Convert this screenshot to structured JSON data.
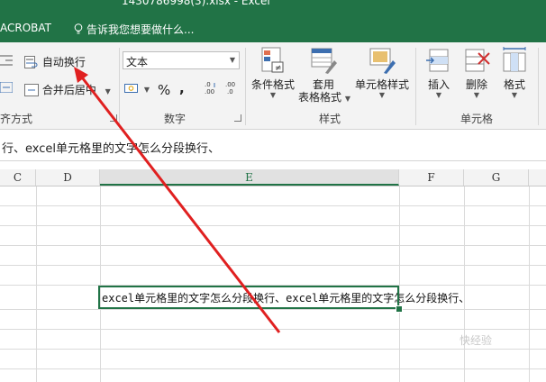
{
  "window": {
    "title": "1430786998(3).xlsx - Excel"
  },
  "menubar": {
    "tab": "ACROBAT",
    "tell_me": "告诉我您想要做什么..."
  },
  "ribbon": {
    "alignment": {
      "wrap_text": "自动换行",
      "merge_center": "合并后居中",
      "group_label": "齐方式"
    },
    "number": {
      "format_value": "文本",
      "percent": "%",
      "comma": ",",
      "group_label": "数字"
    },
    "styles": {
      "conditional": "条件格式",
      "table_line1": "套用",
      "table_line2": "表格格式",
      "cell_styles": "单元格样式",
      "group_label": "样式"
    },
    "cells": {
      "insert": "插入",
      "delete": "删除",
      "format": "格式",
      "group_label": "单元格"
    }
  },
  "formula_bar": {
    "content": "行、excel单元格里的文字怎么分段换行、"
  },
  "columns": [
    {
      "name": "C",
      "selected": false
    },
    {
      "name": "D",
      "selected": false
    },
    {
      "name": "E",
      "selected": true
    },
    {
      "name": "F",
      "selected": false
    },
    {
      "name": "G",
      "selected": false
    }
  ],
  "active_cell": {
    "column": "E",
    "text": "excel单元格里的文字怎么分段换行、excel单元格里的文字怎么分段换行、"
  },
  "watermark": "快经验",
  "colors": {
    "excel_green": "#217346",
    "annotation_red": "#e02020"
  },
  "annotation": {
    "type": "arrow",
    "color": "#e02020",
    "points_to": "wrap-text-button"
  }
}
